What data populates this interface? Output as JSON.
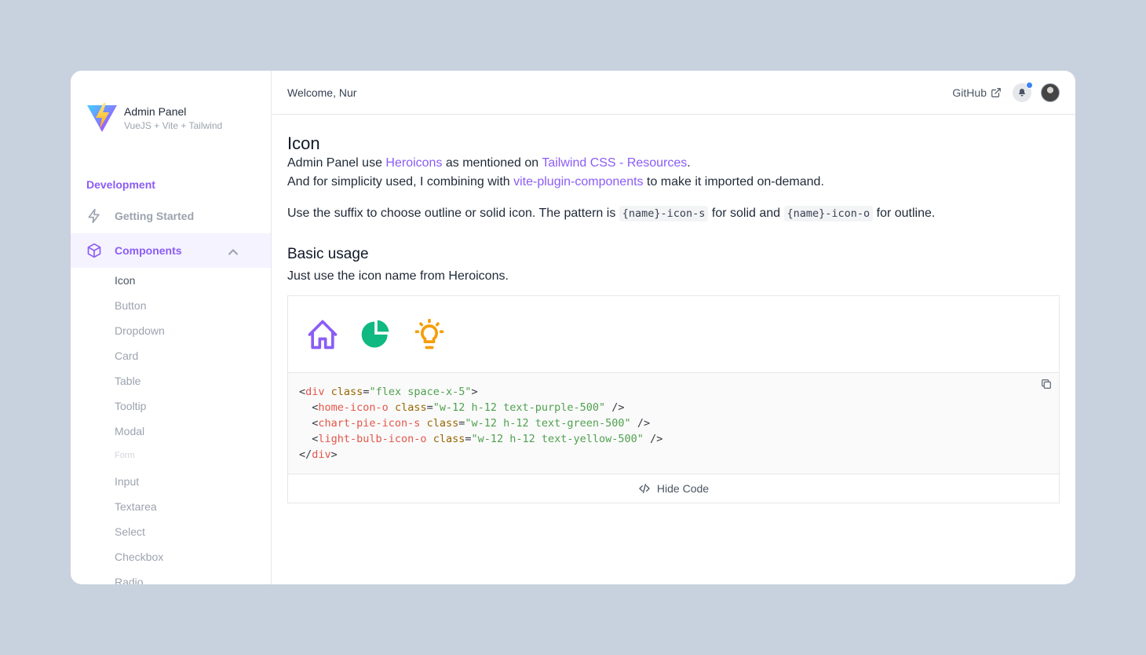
{
  "brand": {
    "title": "Admin Panel",
    "subtitle": "VueJS + Vite + Tailwind"
  },
  "sidebar": {
    "section": "Development",
    "items": [
      {
        "label": "Getting Started",
        "icon": "lightning-icon"
      },
      {
        "label": "Components",
        "icon": "cube-icon"
      }
    ],
    "subitems": [
      "Icon",
      "Button",
      "Dropdown",
      "Card",
      "Table",
      "Tooltip",
      "Modal"
    ],
    "form_label": "Form",
    "form_items": [
      "Input",
      "Textarea",
      "Select",
      "Checkbox",
      "Radio"
    ]
  },
  "header": {
    "welcome": "Welcome, Nur",
    "github": "GitHub"
  },
  "content": {
    "title": "Icon",
    "p1_a": "Admin Panel use ",
    "p1_link1": "Heroicons",
    "p1_b": " as mentioned on ",
    "p1_link2": "Tailwind CSS - Resources",
    "p1_c": ".",
    "p2_a": "And for simplicity used, I combining with ",
    "p2_link": "vite-plugin-components",
    "p2_b": " to make it imported on-demand.",
    "p3_a": "Use the suffix to choose outline or solid icon. The pattern is ",
    "p3_code1": "{name}-icon-s",
    "p3_b": " for solid and ",
    "p3_code2": "{name}-icon-o",
    "p3_c": " for outline.",
    "h2": "Basic usage",
    "p4": "Just use the icon name from Heroicons.",
    "hide_code": "Hide Code"
  },
  "code": {
    "l1_open": "<",
    "l1_tag": "div",
    "l1_attr": "class",
    "l1_eq": "=",
    "l1_val": "\"flex space-x-5\"",
    "l1_close": ">",
    "l2_pre": "  <",
    "l2_tag": "home-icon-o",
    "l2_attr": "class",
    "l2_val": "\"w-12 h-12 text-purple-500\"",
    "l2_end": " />",
    "l3_pre": "  <",
    "l3_tag": "chart-pie-icon-s",
    "l3_attr": "class",
    "l3_val": "\"w-12 h-12 text-green-500\"",
    "l3_end": " />",
    "l4_pre": "  <",
    "l4_tag": "light-bulb-icon-o",
    "l4_attr": "class",
    "l4_val": "\"w-12 h-12 text-yellow-500\"",
    "l4_end": " />",
    "l5_open": "</",
    "l5_tag": "div",
    "l5_close": ">"
  },
  "colors": {
    "accent": "#8b5cf6",
    "green": "#10b981",
    "yellow": "#f59e0b",
    "background": "#c8d2de"
  }
}
